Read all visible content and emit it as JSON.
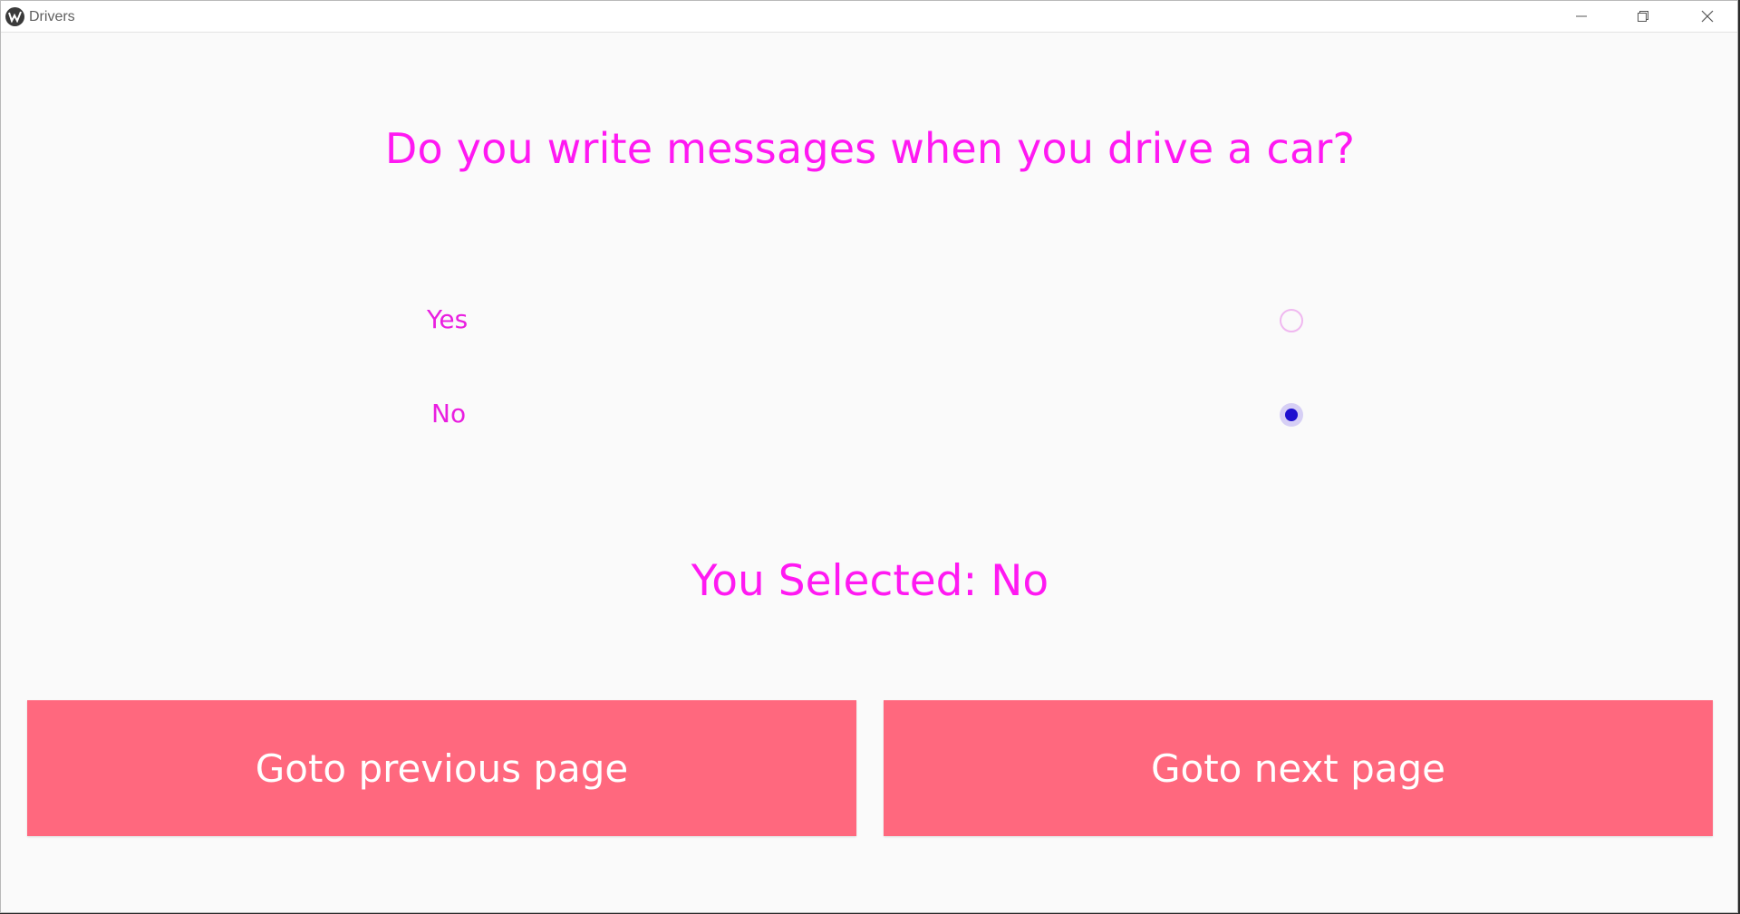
{
  "window": {
    "title": "Drivers",
    "controls": {
      "minimize_icon": "minimize-icon",
      "maximize_icon": "restore-icon",
      "close_icon": "close-icon"
    }
  },
  "question": {
    "text": "Do you write messages when you drive a car?"
  },
  "options": [
    {
      "label": "Yes",
      "selected": false
    },
    {
      "label": "No",
      "selected": true
    }
  ],
  "result": {
    "text": "You Selected: No"
  },
  "buttons": {
    "previous": "Goto previous page",
    "next": "Goto next page"
  },
  "colors": {
    "accent": "#ff19f2",
    "button_bg": "#ff687e",
    "radio_selected": "#1e0fcf",
    "background": "#fafafa"
  }
}
